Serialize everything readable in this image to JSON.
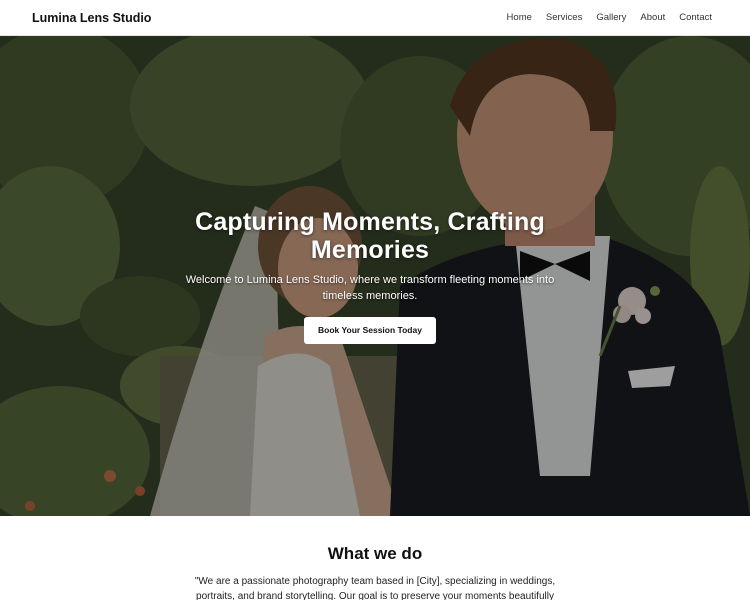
{
  "navbar": {
    "brand": "Lumina Lens Studio",
    "links": [
      "Home",
      "Services",
      "Gallery",
      "About",
      "Contact"
    ]
  },
  "hero": {
    "title_line1": "Capturing Moments, Crafting",
    "title_line2": "Memories",
    "subtitle": "Welcome to Lumina Lens Studio, where we transform fleeting moments into timeless memories.",
    "cta_label": "Book Your Session Today"
  },
  "about": {
    "title": "What we do",
    "text": "\"We are a passionate photography team based in [City], specializing in weddings, portraits, and brand storytelling. Our goal is to preserve your moments beautifully"
  },
  "colors": {
    "nav_bg": "#ffffff",
    "cta_bg": "#ffffff",
    "hero_overlay": "rgba(0,0,0,0.38)"
  }
}
